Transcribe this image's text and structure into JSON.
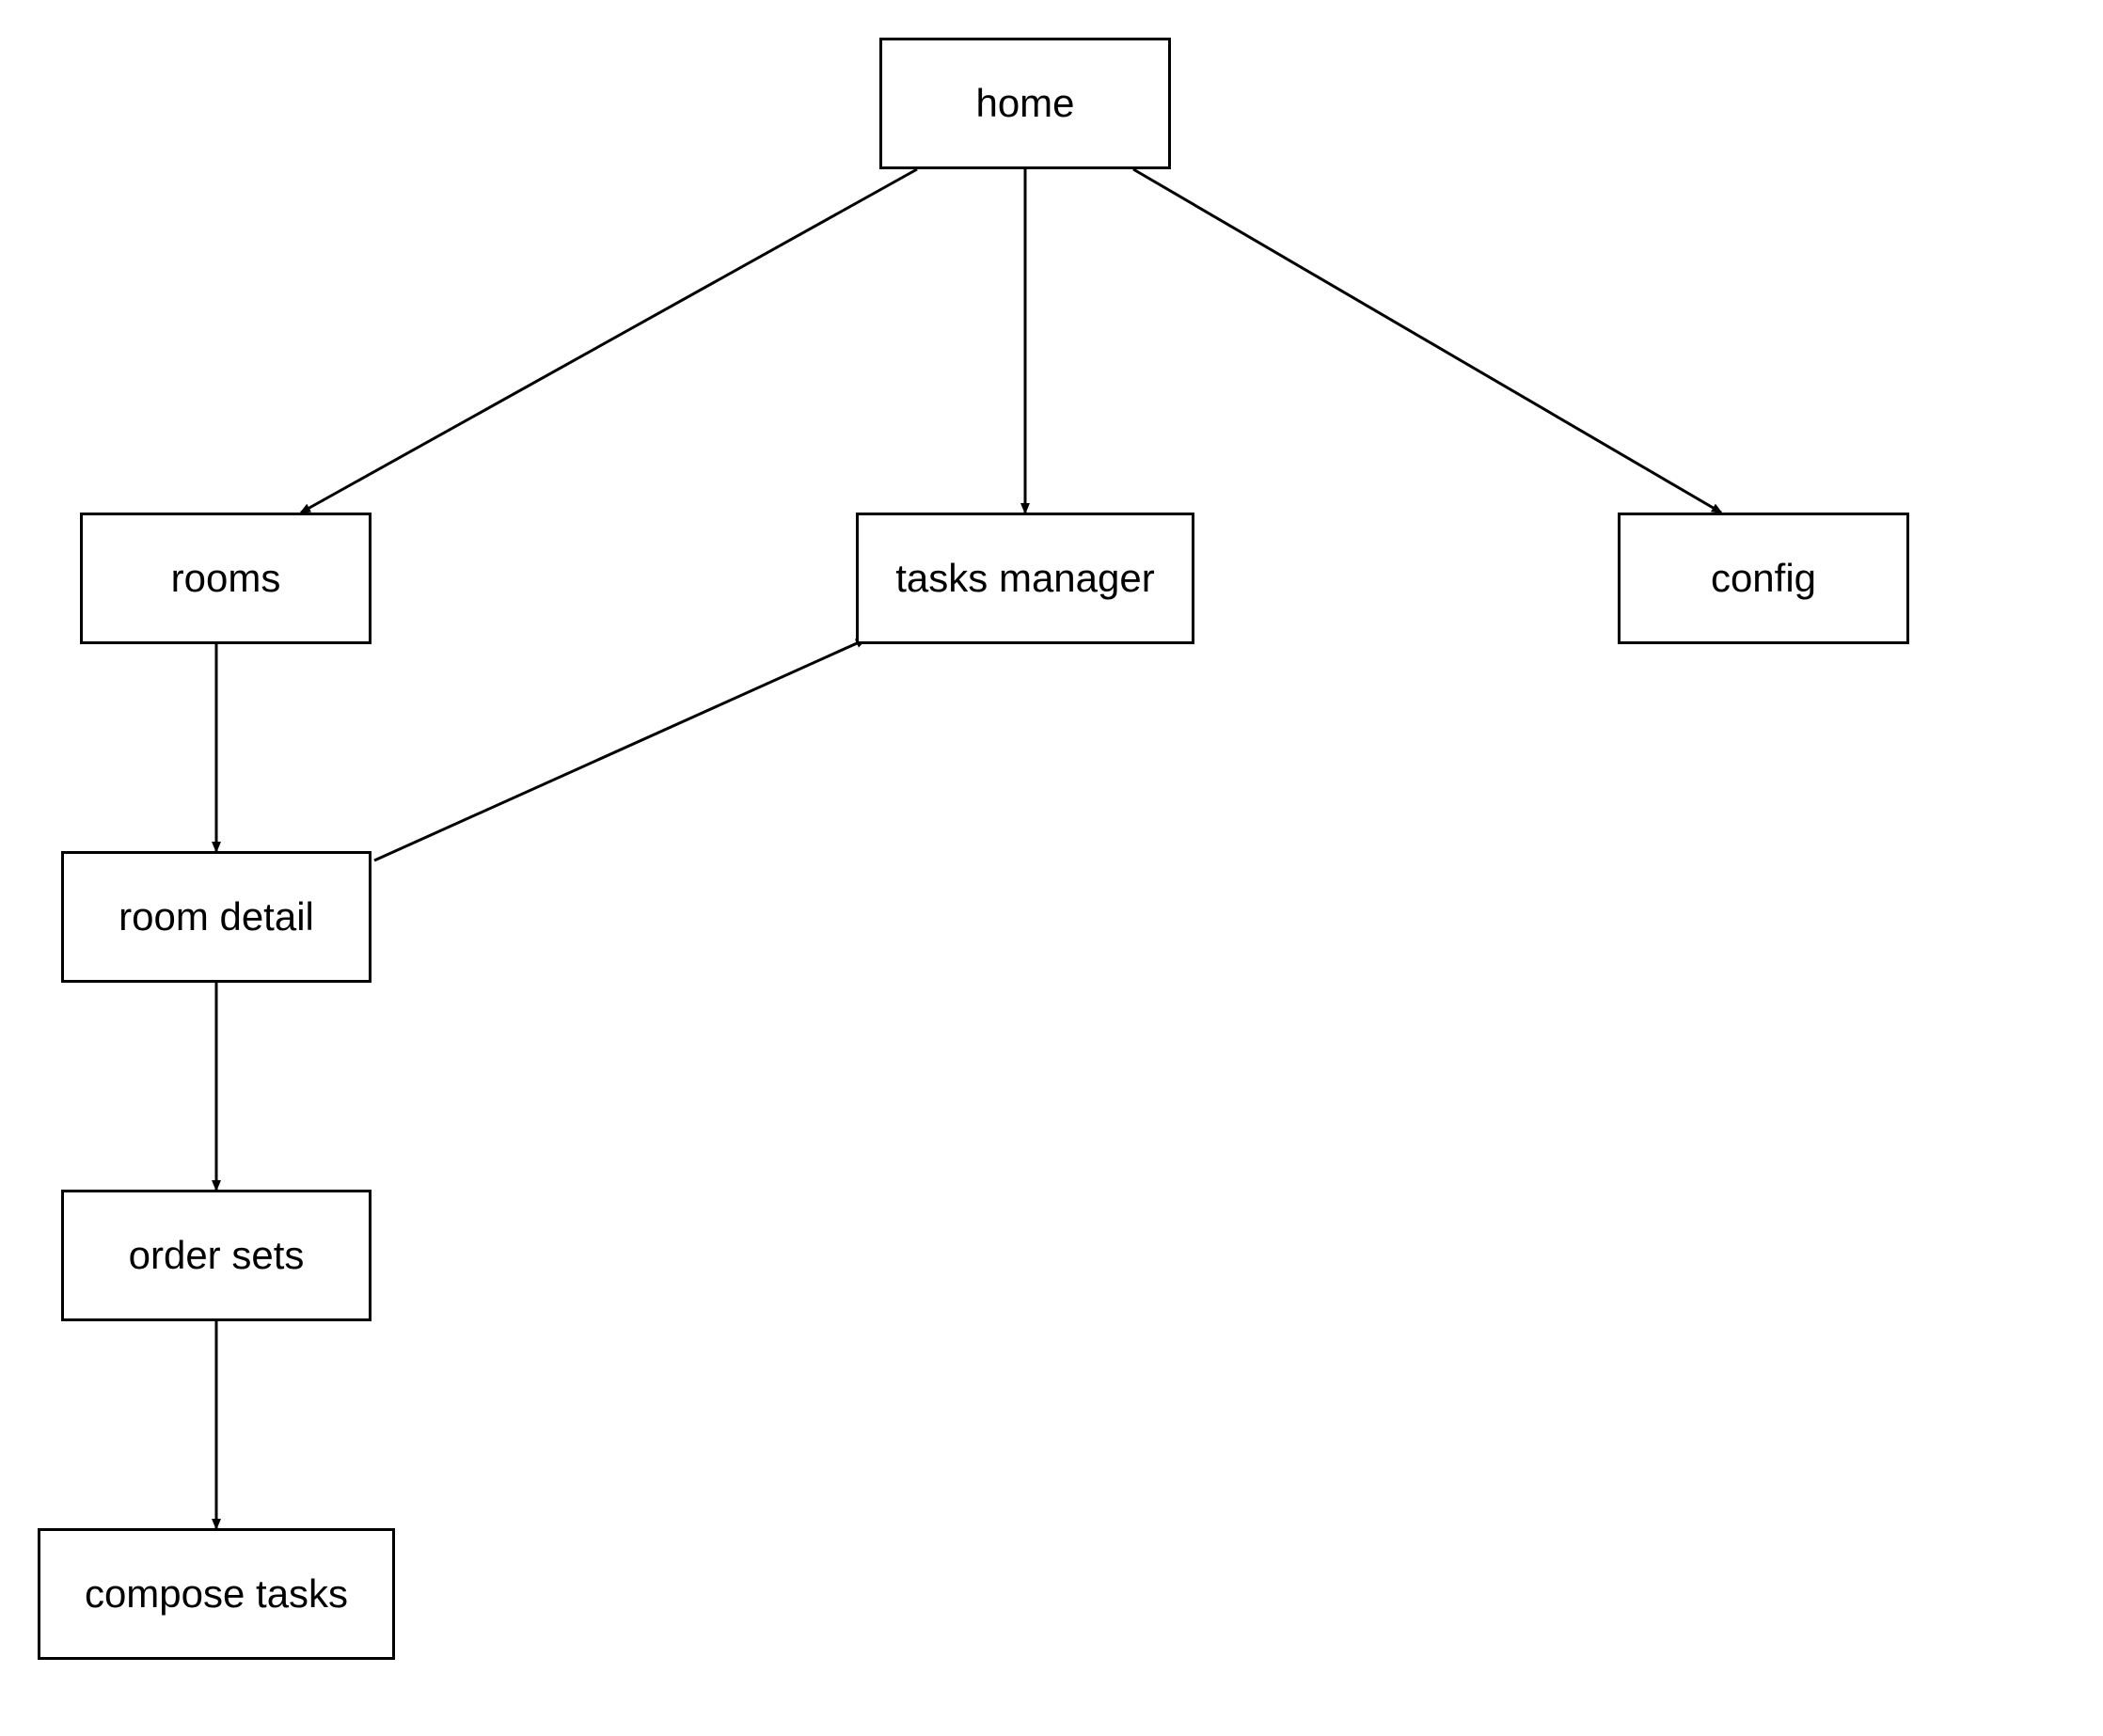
{
  "nodes": {
    "home": {
      "label": "home"
    },
    "rooms": {
      "label": "rooms"
    },
    "tasks_manager": {
      "label": "tasks manager"
    },
    "config": {
      "label": "config"
    },
    "room_detail": {
      "label": "room detail"
    },
    "order_sets": {
      "label": "order sets"
    },
    "compose_tasks": {
      "label": "compose tasks"
    }
  }
}
